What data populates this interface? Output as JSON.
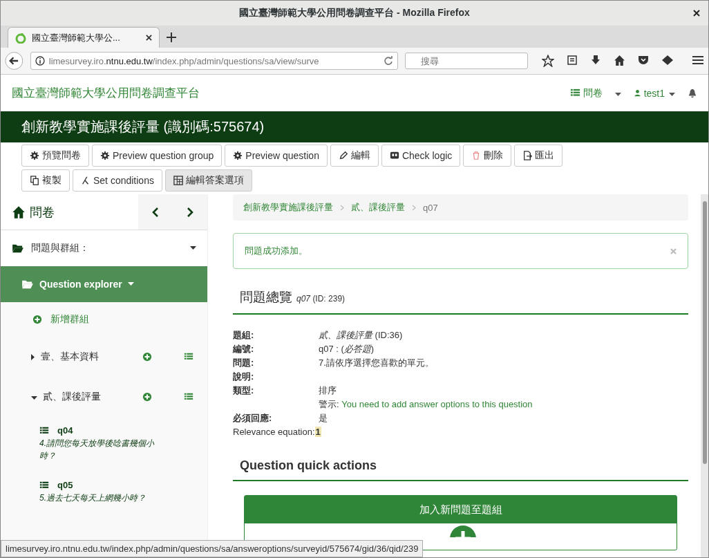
{
  "window": {
    "title": "國立臺灣師範大學公用問卷調查平台 - Mozilla Firefox"
  },
  "browser": {
    "tab": "國立臺灣師範大學公...",
    "url_pre": "limesurvey.iro.",
    "url_host": "ntnu.edu.tw",
    "url_post": "/index.php/admin/questions/sa/view/surve",
    "search_placeholder": "搜尋"
  },
  "app": {
    "brand": "國立臺灣師範大學公用問卷調查平台",
    "nav": [
      {
        "kind": "list",
        "label": "問卷"
      },
      {
        "kind": "user",
        "label": "test1"
      }
    ]
  },
  "survey_title": "創新教學實施課後評量 (識別碼:575674)",
  "toolbar": [
    {
      "kind": "gear",
      "label": "預覽問卷",
      "hovered": false
    },
    {
      "kind": "gear",
      "label": "Preview question group",
      "hovered": false
    },
    {
      "kind": "gear",
      "label": "Preview question",
      "hovered": false
    },
    {
      "kind": "pencil",
      "label": "編輯",
      "hovered": false
    },
    {
      "kind": "qa",
      "label": "Check logic",
      "hovered": false
    },
    {
      "kind": "trash",
      "label": "刪除",
      "hovered": false
    },
    {
      "kind": "export",
      "label": "匯出",
      "hovered": false
    },
    {
      "kind": "copy",
      "label": "複製",
      "hovered": false
    },
    {
      "kind": "branch",
      "label": "Set conditions",
      "hovered": false
    },
    {
      "kind": "grid",
      "label": "編輯答案選項",
      "hovered": true
    }
  ],
  "sidebar": {
    "title": "問卷",
    "menu": "問題與群組：",
    "explorer": {
      "label": "Question explorer",
      "selected": true
    },
    "add_group": "新增群組",
    "groups": [
      {
        "name": "壹、基本資料",
        "expanded": false
      },
      {
        "name": "貳、課後評量",
        "expanded": true,
        "questions": [
          {
            "code": "q04",
            "text": "4.請問您每天放學後唸書幾個小時？"
          },
          {
            "code": "q05",
            "text": "5.過去七天每天上網幾小時？"
          }
        ]
      }
    ]
  },
  "breadcrumb": [
    "創新教學實施課後評量",
    "貳、課後評量",
    "q07"
  ],
  "alert": "問題成功添加。",
  "overview": {
    "title": "問題總覽",
    "code": "q07",
    "id": "(ID: 239)",
    "fields": [
      {
        "kind": "field",
        "label": "題組:",
        "value": "*貳、課後評量* (ID:36)"
      },
      {
        "kind": "field",
        "label": "編號:",
        "value": "q07 : (*必答題*)"
      },
      {
        "kind": "field",
        "label": "問題:",
        "value": "7.請依序選擇您喜歡的單元。"
      },
      {
        "kind": "field",
        "label": "說明:"
      },
      {
        "kind": "field",
        "label": "類型:",
        "value": "排序"
      },
      {
        "kind": "warning",
        "label": "警示:",
        "value": "You need to add answer options to this question"
      },
      {
        "kind": "field",
        "label": "必須回應:",
        "value": "是"
      },
      {
        "kind": "relevance",
        "label": "Relevance equation:",
        "value": "1"
      }
    ]
  },
  "quick_actions": {
    "title": "Question quick actions",
    "card_title": "加入新問題至題組"
  },
  "status_url": "limesurvey.iro.ntnu.edu.tw/index.php/admin/questions/sa/answeroptions/surveyid/575674/gid/36/qid/239"
}
